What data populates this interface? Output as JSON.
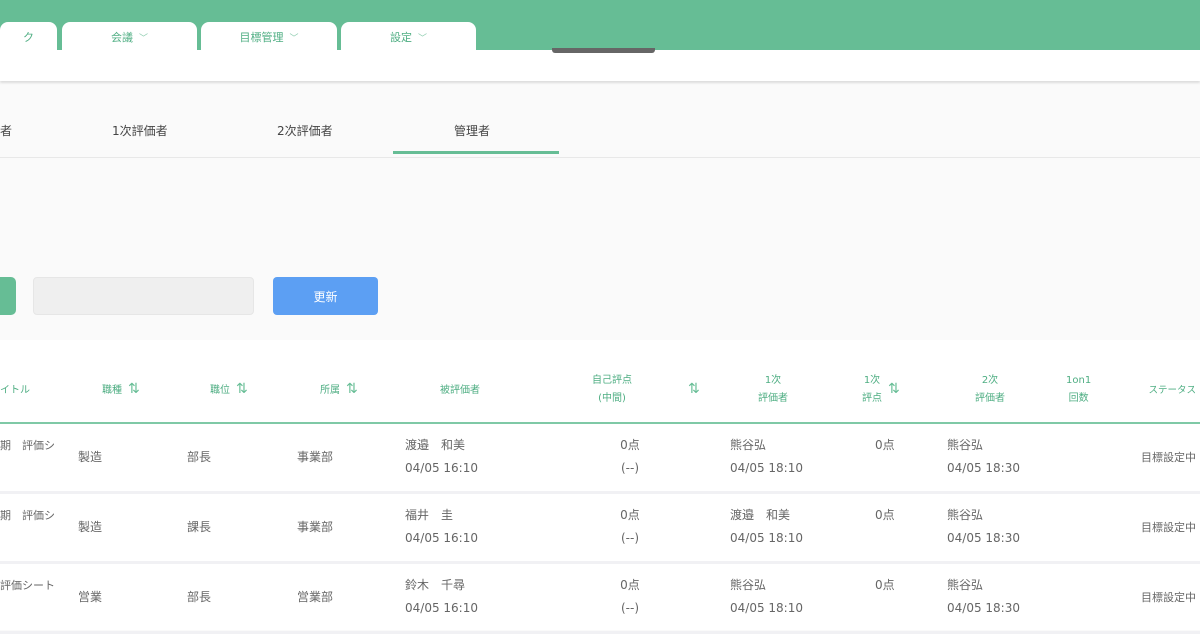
{
  "nav": {
    "tabs": [
      {
        "label": "ク"
      },
      {
        "label": "会議"
      },
      {
        "label": "目標管理"
      },
      {
        "label": "設定"
      }
    ]
  },
  "subtabs": {
    "items": [
      {
        "label": "者"
      },
      {
        "label": "1次評価者"
      },
      {
        "label": "2次評価者"
      },
      {
        "label": "管理者"
      }
    ],
    "active": "管理者"
  },
  "filters": {
    "input_value": "",
    "update_label": "更新"
  },
  "table": {
    "headers": {
      "title": "イトル",
      "job": "職種",
      "position": "職位",
      "dept": "所属",
      "evaluatee": "被評価者",
      "self_score_1": "自己評点",
      "self_score_2": "(中間)",
      "first_eval_1": "1次",
      "first_eval_2": "評価者",
      "first_score_1": "1次",
      "first_score_2": "評点",
      "second_eval_1": "2次",
      "second_eval_2": "評価者",
      "oneonone_1": "1on1",
      "oneonone_2": "回数",
      "status": "ステータス"
    },
    "rows": [
      {
        "title": "期　評価シ",
        "job": "製造",
        "position": "部長",
        "dept": "事業部",
        "evaluatee": "渡邉　和美",
        "evaluatee_time": "04/05 16:10",
        "self_score": "0点",
        "self_mid": "(--)",
        "first_eval": "熊谷弘",
        "first_time": "04/05 18:10",
        "first_score": "0点",
        "second_eval": "熊谷弘",
        "second_time": "04/05 18:30",
        "status": "目標設定中"
      },
      {
        "title": "期　評価シ",
        "job": "製造",
        "position": "課長",
        "dept": "事業部",
        "evaluatee": "福井　圭",
        "evaluatee_time": "04/05 16:10",
        "self_score": "0点",
        "self_mid": "(--)",
        "first_eval": "渡邉　和美",
        "first_time": "04/05 18:10",
        "first_score": "0点",
        "second_eval": "熊谷弘",
        "second_time": "04/05 18:30",
        "status": "目標設定中"
      },
      {
        "title": " 評価シート",
        "job": "営業",
        "position": "部長",
        "dept": "営業部",
        "evaluatee": "鈴木　千尋",
        "evaluatee_time": "04/05 16:10",
        "self_score": "0点",
        "self_mid": "(--)",
        "first_eval": "熊谷弘",
        "first_time": "04/05 18:10",
        "first_score": "0点",
        "second_eval": "熊谷弘",
        "second_time": "04/05 18:30",
        "status": "目標設定中"
      }
    ]
  }
}
